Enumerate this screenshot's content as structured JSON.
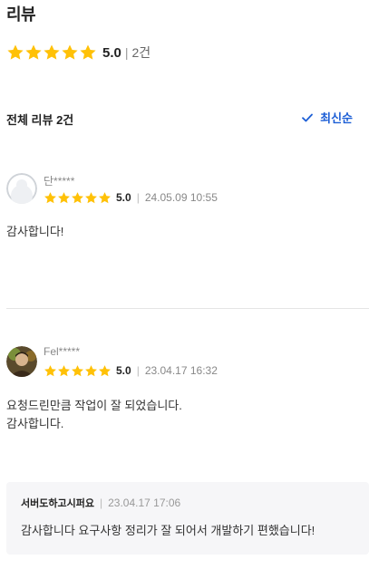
{
  "page": {
    "title": "리뷰"
  },
  "summary": {
    "rating": "5.0",
    "separator": "|",
    "count": "2건",
    "stars": 5
  },
  "list": {
    "header": "전체 리뷰 2건",
    "sort_label": "최신순"
  },
  "reviews": [
    {
      "reviewer": "단*****",
      "rating": "5.0",
      "separator": "|",
      "date": "24.05.09 10:55",
      "text_lines": [
        "감사합니다!"
      ]
    },
    {
      "reviewer": "Fel*****",
      "rating": "5.0",
      "separator": "|",
      "date": "23.04.17 16:32",
      "text_lines": [
        "요청드린만큼 작업이 잘 되었습니다.",
        "감사합니다."
      ],
      "reply": {
        "author": "서버도하고시퍼요",
        "separator": "|",
        "date": "23.04.17 17:06",
        "text": "감사합니다 요구사항 정리가 잘 되어서 개발하기 편했습니다!"
      }
    }
  ],
  "colors": {
    "star": "#FFC107",
    "accent": "#1D5FD6",
    "reply_bg": "#F6F6F8"
  }
}
